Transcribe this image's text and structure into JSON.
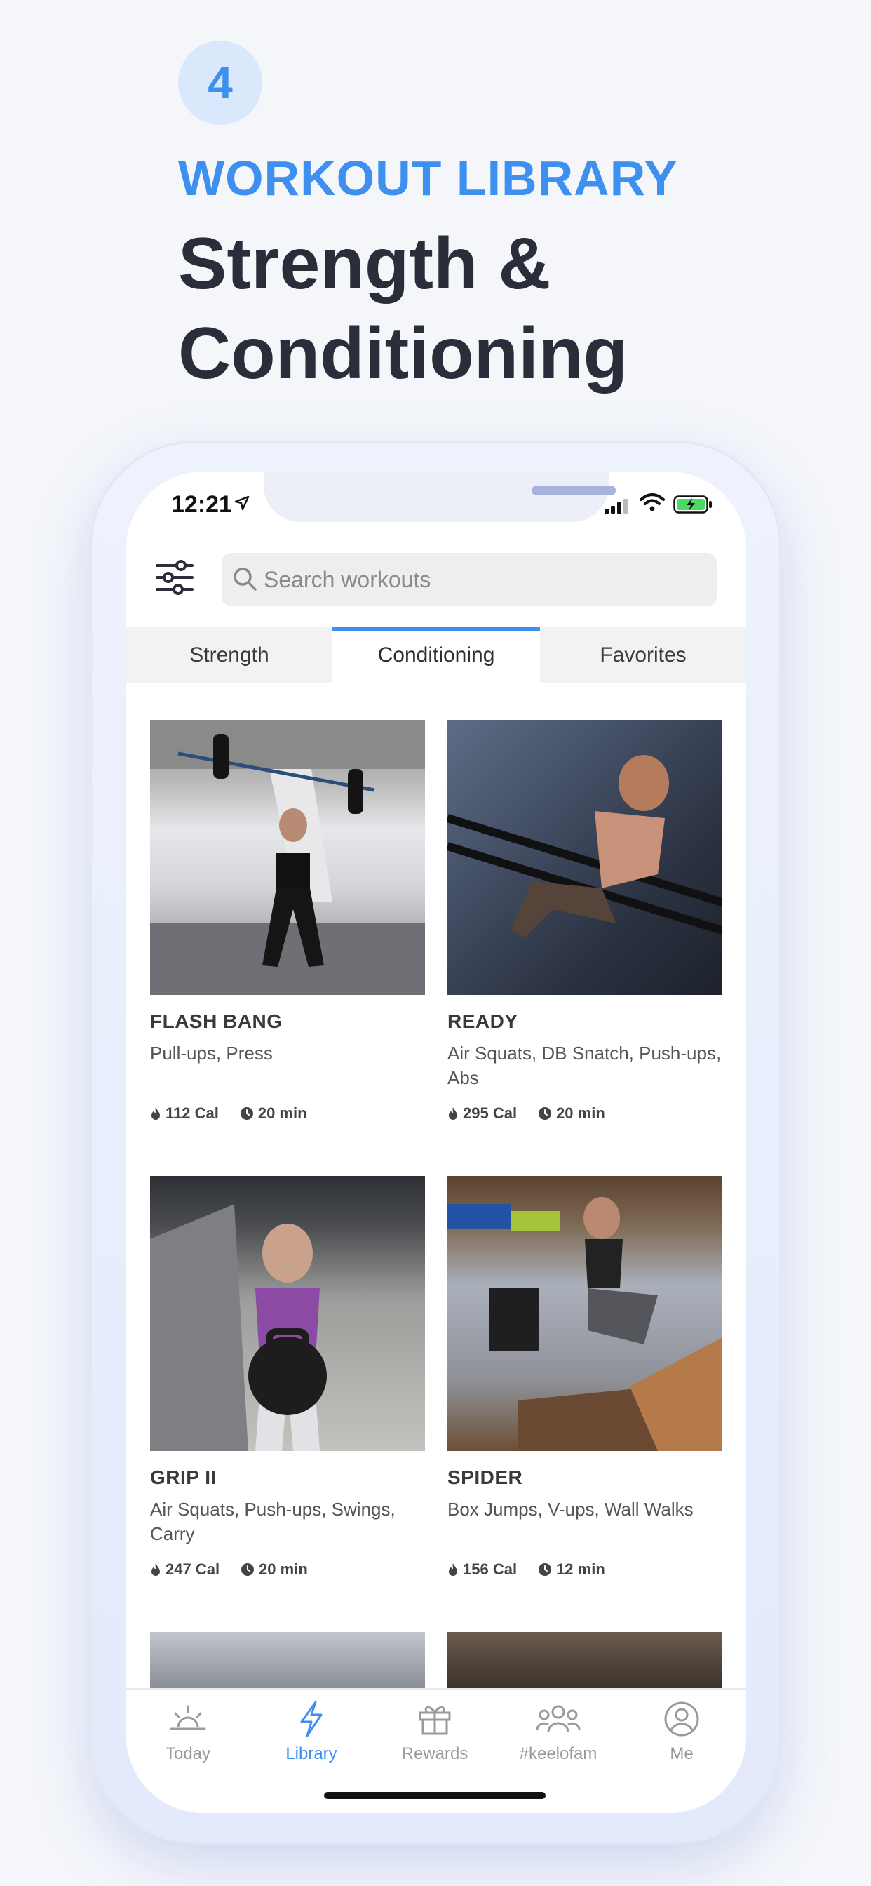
{
  "marketing": {
    "step_number": "4",
    "kicker": "WORKOUT LIBRARY",
    "headline": "Strength & Conditioning"
  },
  "status_bar": {
    "time": "12:21"
  },
  "search": {
    "placeholder": "Search workouts"
  },
  "tabs": [
    {
      "label": "Strength",
      "active": false
    },
    {
      "label": "Conditioning",
      "active": true
    },
    {
      "label": "Favorites",
      "active": false
    }
  ],
  "workouts": [
    {
      "title": "FLASH BANG",
      "desc": "Pull-ups, Press",
      "cal": "112 Cal",
      "time": "20 min"
    },
    {
      "title": "READY",
      "desc": "Air Squats, DB Snatch, Push-ups, Abs",
      "cal": "295 Cal",
      "time": "20 min"
    },
    {
      "title": "GRIP II",
      "desc": "Air Squats, Push-ups, Swings, Carry",
      "cal": "247 Cal",
      "time": "20 min"
    },
    {
      "title": "SPIDER",
      "desc": "Box Jumps, V-ups, Wall Walks",
      "cal": "156 Cal",
      "time": "12 min"
    }
  ],
  "tabbar": [
    {
      "label": "Today",
      "icon": "sunrise-icon",
      "active": false
    },
    {
      "label": "Library",
      "icon": "lightning-icon",
      "active": true
    },
    {
      "label": "Rewards",
      "icon": "gift-icon",
      "active": false
    },
    {
      "label": "#keelofam",
      "icon": "group-icon",
      "active": false
    },
    {
      "label": "Me",
      "icon": "profile-icon",
      "active": false
    }
  ],
  "colors": {
    "accent": "#3d8ff0",
    "headline": "#2b2d3a",
    "background": "#f4f6fa"
  }
}
